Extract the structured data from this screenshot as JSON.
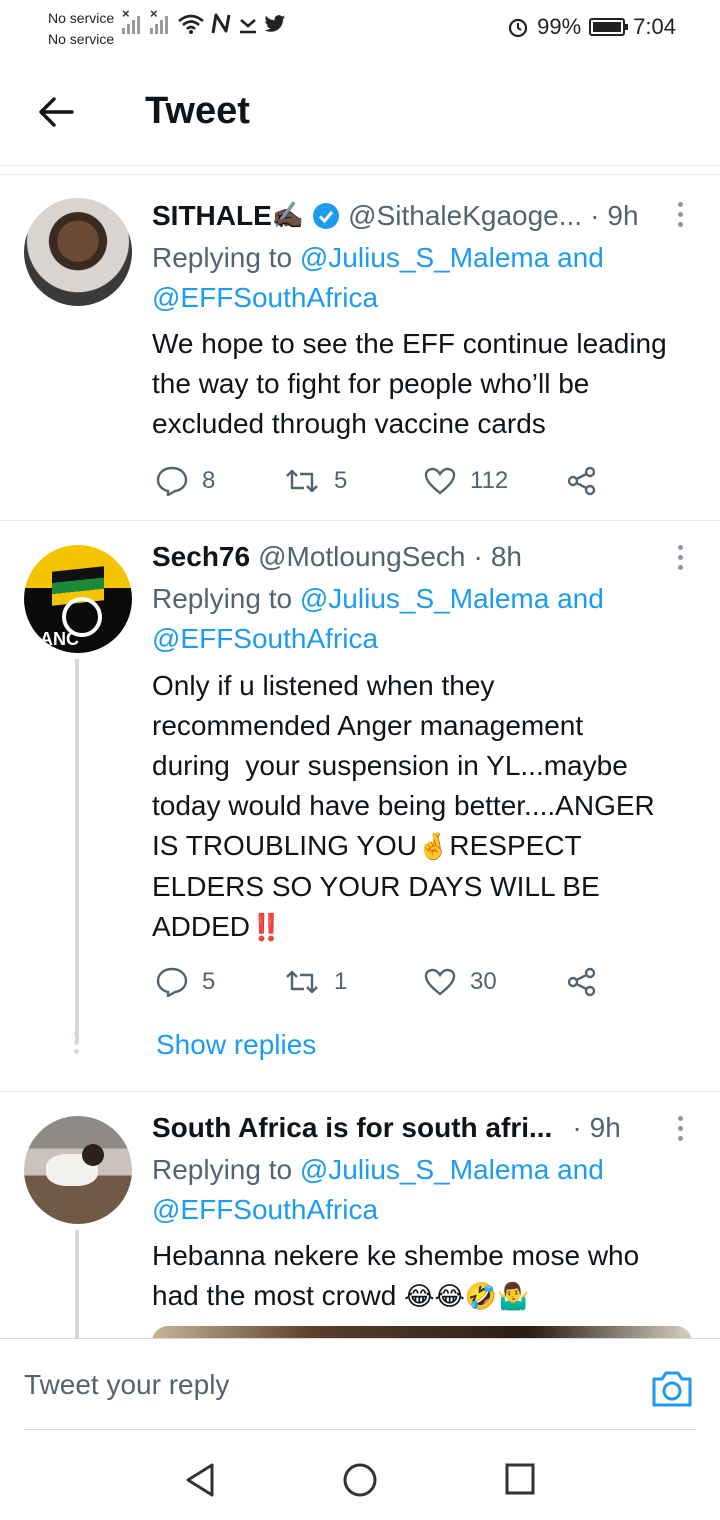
{
  "status_bar": {
    "carrier_1": "No service",
    "carrier_2": "No service",
    "battery": "99%",
    "time": "7:04"
  },
  "header": {
    "title": "Tweet",
    "back_icon": "arrow-left-icon"
  },
  "tweets": [
    {
      "name": "SITHALE",
      "name_emoji": "✍🏿",
      "verified": true,
      "handle": "@SithaleKgaoge...",
      "dot": "·",
      "time": "9h",
      "replying_prefix": "Replying to",
      "replying_to_1": "@Julius_S_Malema",
      "replying_and": "and",
      "replying_to_2": "@EFFSouthAfrica",
      "body": "We hope to see the EFF continue leading the way to fight for people who’ll be excluded through vaccine cards",
      "replies": "8",
      "retweets": "5",
      "likes": "112"
    },
    {
      "name": "Sech76",
      "handle": "@MotloungSech",
      "dot": "·",
      "time": "8h",
      "replying_prefix": "Replying to",
      "replying_to_1": "@Julius_S_Malema",
      "replying_and": "and",
      "replying_to_2": "@EFFSouthAfrica",
      "body_line_1": "Only if u listened when they",
      "body_line_2": "recommended Anger management",
      "body_line_3": "during  your suspension in YL...maybe",
      "body_line_4": "today would have being better....ANGER",
      "body_line_5": "IS TROUBLING YOU",
      "body_emoji_1": "🤞",
      "body_line_5b": "RESPECT",
      "body_line_6": "ELDERS SO YOUR DAYS WILL BE",
      "body_line_7": "ADDED",
      "body_emoji_2": "‼️",
      "replies": "5",
      "retweets": "1",
      "likes": "30",
      "show_replies": "Show replies",
      "avatar_label": "ANC"
    },
    {
      "name": "South Africa is for south afri...",
      "dot": "·",
      "time": "9h",
      "replying_prefix": "Replying to",
      "replying_to_1": "@Julius_S_Malema",
      "replying_and": "and",
      "replying_to_2": "@EFFSouthAfrica",
      "body_line_1": "Hebanna nekere ke shembe mose who",
      "body_line_2": "had the most crowd",
      "body_emojis": "😂😂🤣🤷‍♂️"
    }
  ],
  "reply_bar": {
    "placeholder": "Tweet your reply",
    "camera_icon": "camera-icon"
  },
  "colors": {
    "link": "#1d9bf0",
    "secondary_text": "#536471",
    "divider": "#e6ecf0"
  }
}
